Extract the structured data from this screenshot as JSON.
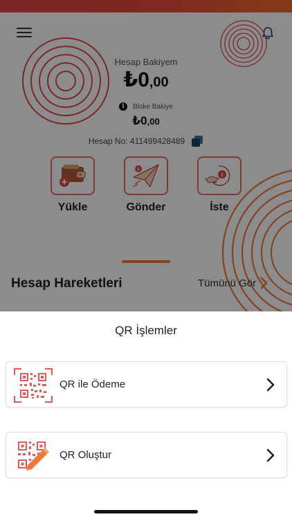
{
  "header": {
    "menu_icon": "hamburger-menu-icon",
    "bell_icon": "bell-icon"
  },
  "balance": {
    "label": "Hesap Bakiyem",
    "currency": "₺",
    "integer": "0",
    "decimal": ",00"
  },
  "blocked": {
    "label": "Bloke Bakiye",
    "currency": "₺",
    "integer": "0",
    "decimal": ",00"
  },
  "account": {
    "text": "Hesap No: 411499428489",
    "copy_icon": "copy-icon"
  },
  "actions": [
    {
      "label": "Yükle",
      "icon": "wallet-add-icon"
    },
    {
      "label": "Gönder",
      "icon": "paper-plane-icon"
    },
    {
      "label": "İste",
      "icon": "hand-coin-icon"
    }
  ],
  "transactions": {
    "title": "Hesap Hareketleri",
    "see_all": "Tümünü Gör"
  },
  "sheet": {
    "title": "QR İşlemler",
    "options": [
      {
        "label": "QR ile Ödeme",
        "icon": "qr-scan-icon"
      },
      {
        "label": "QR Oluştur",
        "icon": "qr-create-icon"
      }
    ]
  },
  "colors": {
    "accent_red": "#e46a6a",
    "accent_orange": "#f07a3a",
    "qr_red": "#e05a5a",
    "dim_overlay": "rgba(0,0,0,0.45)"
  }
}
